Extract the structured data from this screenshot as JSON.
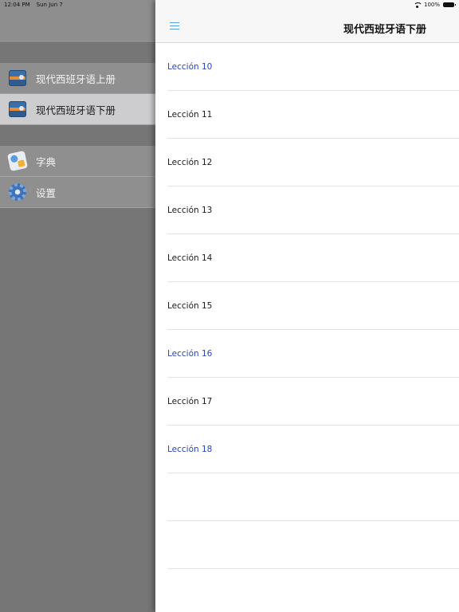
{
  "status_bar": {
    "time": "12:04 PM",
    "date": "Sun Jun 7",
    "battery": "100%"
  },
  "sidebar": {
    "books": [
      {
        "label": "现代西班牙语上册",
        "icon": "book-icon",
        "selected": false
      },
      {
        "label": "现代西班牙语下册",
        "icon": "book-icon",
        "selected": true
      }
    ],
    "tools": [
      {
        "label": "字典",
        "icon": "dictionary-icon"
      },
      {
        "label": "设置",
        "icon": "gear-icon"
      }
    ]
  },
  "navbar": {
    "title": "现代西班牙语下册",
    "menu_icon": "hamburger-menu-icon"
  },
  "lessons": [
    {
      "label": "Lección 10",
      "visited": true
    },
    {
      "label": "Lección 11",
      "visited": false
    },
    {
      "label": "Lección 12",
      "visited": false
    },
    {
      "label": "Lección 13",
      "visited": false
    },
    {
      "label": "Lección 14",
      "visited": false
    },
    {
      "label": "Lección 15",
      "visited": false
    },
    {
      "label": "Lección 16",
      "visited": true
    },
    {
      "label": "Lección 17",
      "visited": false
    },
    {
      "label": "Lección 18",
      "visited": true
    }
  ],
  "colors": {
    "visited_link": "#2a45b8",
    "accent": "#5aa0d8",
    "sidebar_bg": "#767676",
    "selected_row": "#cdcdcf"
  }
}
